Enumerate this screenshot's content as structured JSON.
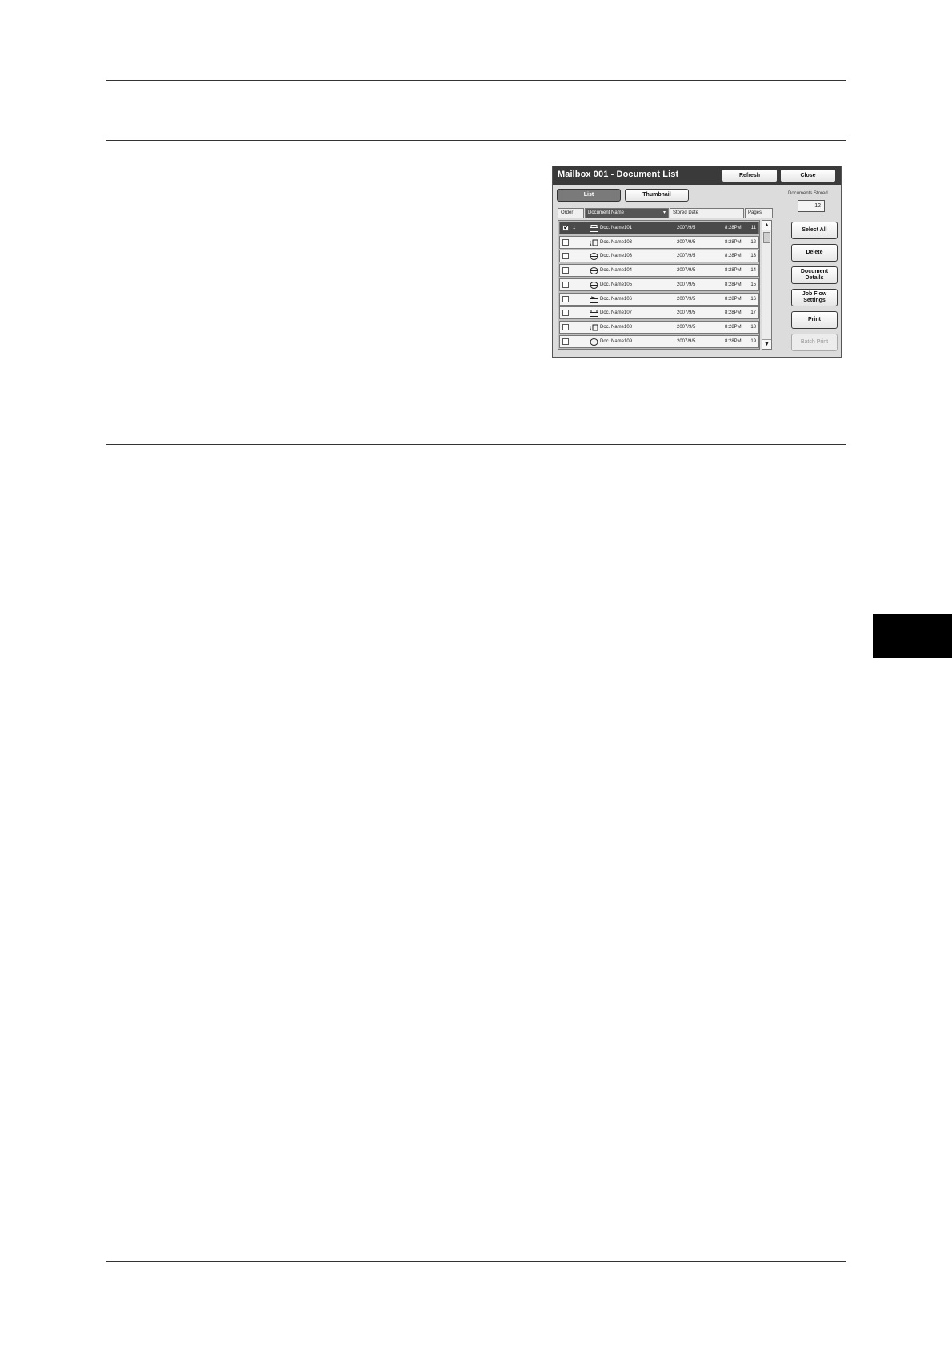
{
  "window": {
    "title": "Mailbox 001 - Document List",
    "refresh_label": "Refresh",
    "close_label": "Close"
  },
  "view_tabs": {
    "list_label": "List",
    "thumbnail_label": "Thumbnail"
  },
  "documents_stored": {
    "label": "Documents Stored",
    "value": "12"
  },
  "columns": {
    "order": "Order",
    "document_name": "Document Name",
    "stored_date": "Stored Date",
    "pages": "Pages"
  },
  "rows": [
    {
      "order": "1",
      "name": "Doc. Name101",
      "date": "2007/9/5",
      "time": "8:28PM",
      "pages": "11",
      "icon": "printer-doc-icon",
      "checked": true
    },
    {
      "order": "",
      "name": "Doc. Name103",
      "date": "2007/9/5",
      "time": "8:28PM",
      "pages": "12",
      "icon": "phone-fax-icon",
      "checked": false
    },
    {
      "order": "",
      "name": "Doc. Name103",
      "date": "2007/9/5",
      "time": "8:28PM",
      "pages": "13",
      "icon": "globe-icon",
      "checked": false
    },
    {
      "order": "",
      "name": "Doc. Name104",
      "date": "2007/9/5",
      "time": "8:28PM",
      "pages": "14",
      "icon": "globe-icon",
      "checked": false
    },
    {
      "order": "",
      "name": "Doc. Name105",
      "date": "2007/9/5",
      "time": "8:28PM",
      "pages": "15",
      "icon": "globe-icon",
      "checked": false
    },
    {
      "order": "",
      "name": "Doc. Name106",
      "date": "2007/9/5",
      "time": "8:28PM",
      "pages": "16",
      "icon": "scanner-icon",
      "checked": false
    },
    {
      "order": "",
      "name": "Doc. Name107",
      "date": "2007/9/5",
      "time": "8:28PM",
      "pages": "17",
      "icon": "printer-doc-icon",
      "checked": false
    },
    {
      "order": "",
      "name": "Doc. Name108",
      "date": "2007/9/5",
      "time": "8:28PM",
      "pages": "18",
      "icon": "phone-fax-icon",
      "checked": false
    },
    {
      "order": "",
      "name": "Doc. Name109",
      "date": "2007/9/5",
      "time": "8:28PM",
      "pages": "19",
      "icon": "globe-icon",
      "checked": false
    }
  ],
  "actions": {
    "select_all": "Select All",
    "delete": "Delete",
    "document_details": "Document Details",
    "job_flow_settings": "Job Flow Settings",
    "print": "Print",
    "batch_print": "Batch Print"
  },
  "glyphs": {
    "checkmark": "✔",
    "sort_arrow": "▾",
    "scroll_up": "▲",
    "scroll_down": "▼"
  }
}
